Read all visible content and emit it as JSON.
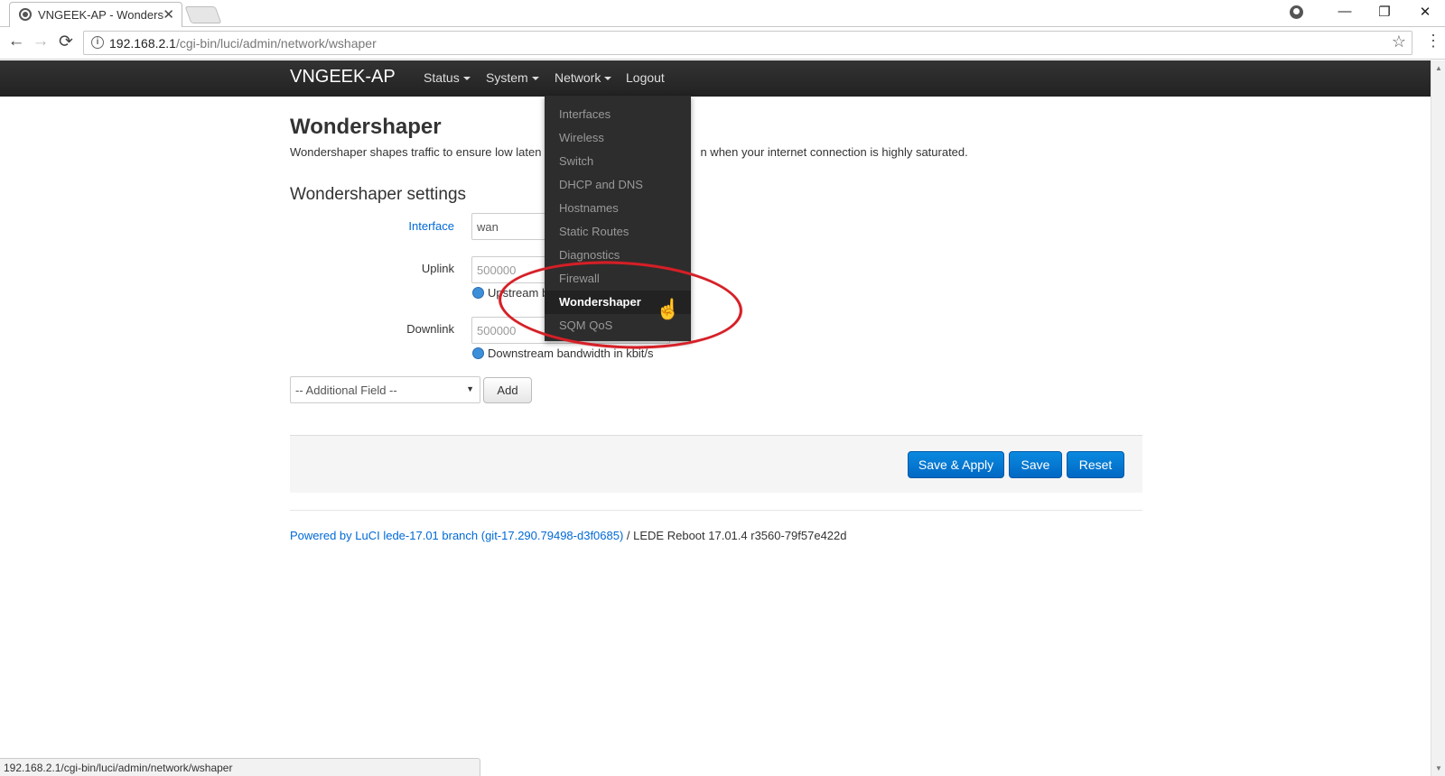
{
  "browser": {
    "tab_title": "VNGEEK-AP - Wondershaper",
    "tab_close": "✕",
    "url_host": "192.168.2.1",
    "url_path": "/cgi-bin/luci/admin/network/wshaper",
    "info_glyph": "i",
    "back_glyph": "←",
    "forward_glyph": "→",
    "reload_glyph": "⟳",
    "star_glyph": "☆",
    "menu_glyph": "⋮",
    "minimize_glyph": "—",
    "restore_glyph": "❐",
    "close_glyph": "✕",
    "status_url": "192.168.2.1/cgi-bin/luci/admin/network/wshaper"
  },
  "header": {
    "brand": "VNGEEK-AP",
    "menu": [
      {
        "label": "Status"
      },
      {
        "label": "System"
      },
      {
        "label": "Network"
      },
      {
        "label": "Logout"
      }
    ]
  },
  "dropdown": {
    "items": [
      {
        "label": "Interfaces"
      },
      {
        "label": "Wireless"
      },
      {
        "label": "Switch"
      },
      {
        "label": "DHCP and DNS"
      },
      {
        "label": "Hostnames"
      },
      {
        "label": "Static Routes"
      },
      {
        "label": "Diagnostics"
      },
      {
        "label": "Firewall"
      },
      {
        "label": "Wondershaper"
      },
      {
        "label": "SQM QoS"
      }
    ],
    "active": "Wondershaper"
  },
  "page": {
    "title": "Wondershaper",
    "description_start": "Wondershaper shapes traffic to ensure low laten",
    "description_end": "n when your internet connection is highly saturated.",
    "section_title": "Wondershaper settings",
    "fields": {
      "interface": {
        "label": "Interface",
        "value": "wan"
      },
      "uplink": {
        "label": "Uplink",
        "placeholder": "500000",
        "hint": "Upstream b"
      },
      "downlink": {
        "label": "Downlink",
        "placeholder": "500000",
        "hint": "Downstream bandwidth in kbit/s"
      }
    },
    "additional_field": "-- Additional Field --",
    "select_arrow": "▼",
    "add_label": "Add"
  },
  "actions": {
    "save_apply": "Save & Apply",
    "save": "Save",
    "reset": "Reset"
  },
  "footer": {
    "link": "Powered by LuCI lede-17.01 branch (git-17.290.79498-d3f0685)",
    "rest": " / LEDE Reboot 17.01.4 r3560-79f57e422d"
  },
  "colors": {
    "header_bg": "#222222",
    "dropdown_bg": "#2d2d2d",
    "link": "#0069d6",
    "primary_button": "#0b7ad6",
    "annotation": "#d51f26"
  }
}
